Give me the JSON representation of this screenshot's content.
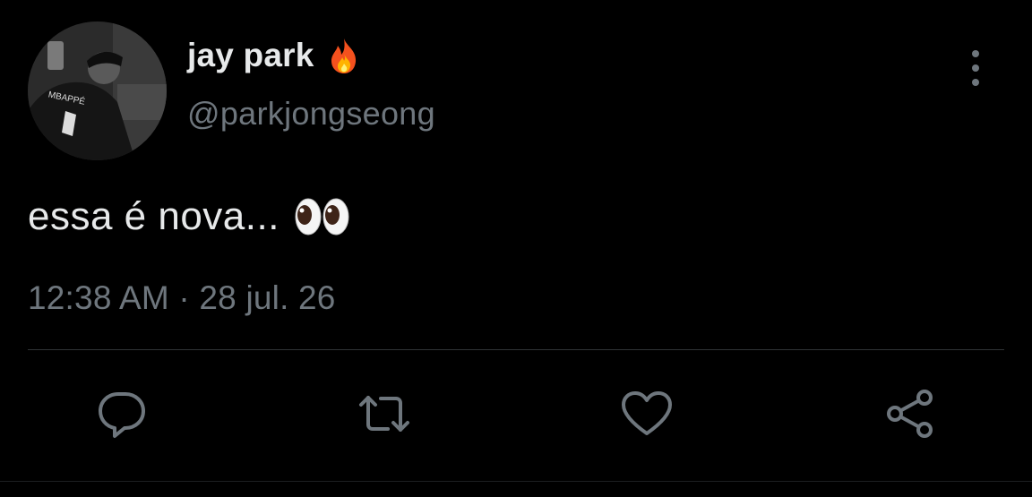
{
  "tweet": {
    "display_name": "jay park",
    "name_emoji_icon": "fire-icon",
    "handle": "@parkjongseong",
    "text": "essa é nova...",
    "text_emoji_icon": "eyes-icon",
    "timestamp": "12:38 AM · 28 jul. 26"
  },
  "avatar": {
    "shirt_text": "MBAPPÉ"
  },
  "actions": [
    {
      "name": "reply",
      "icon": "reply-bubble-icon"
    },
    {
      "name": "retweet",
      "icon": "retweet-icon"
    },
    {
      "name": "like",
      "icon": "heart-icon"
    },
    {
      "name": "share",
      "icon": "share-icon"
    }
  ],
  "colors": {
    "background": "#000000",
    "primary_text": "#e7e9ea",
    "secondary_text": "#6e767d",
    "divider": "#2f3336"
  }
}
